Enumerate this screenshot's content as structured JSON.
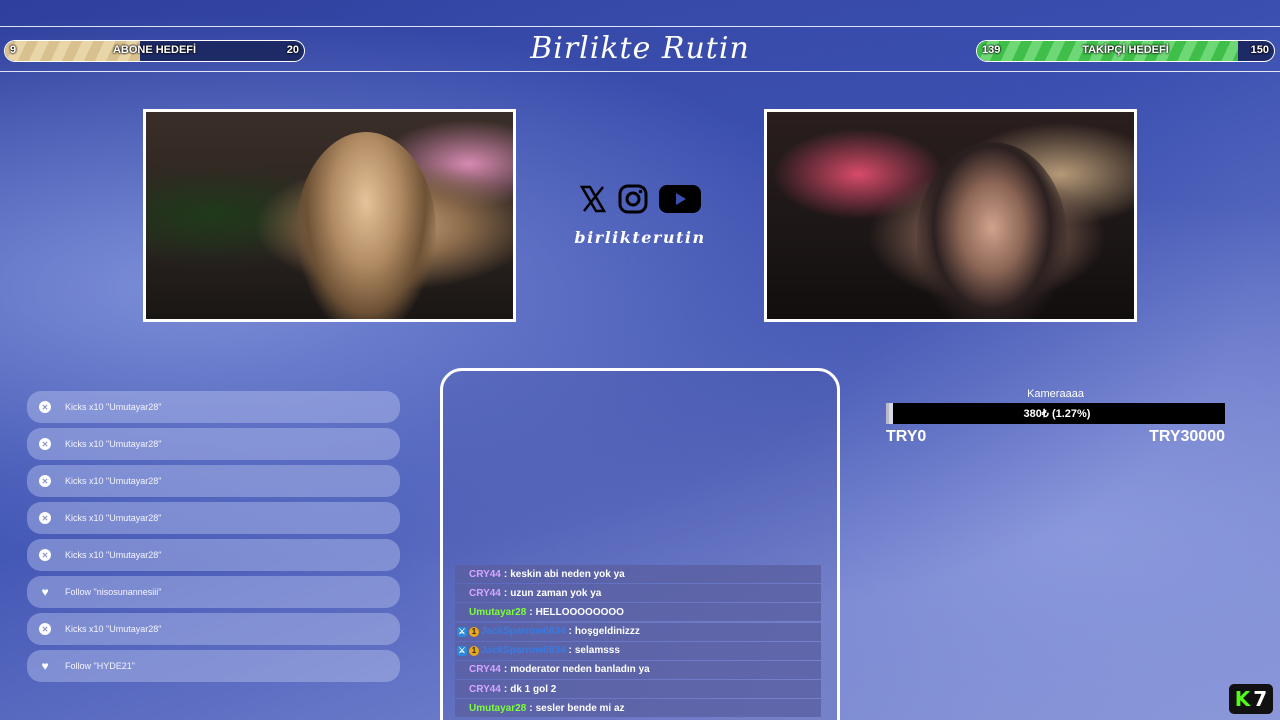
{
  "top_bar": {
    "sub_goal": {
      "min": "9",
      "label": "ABONE HEDEFİ",
      "max": "20",
      "progress": 0.45
    },
    "title": "Birlikte Rutin",
    "follow_goal": {
      "min": "139",
      "label": "TAKİPÇİ HEDEFİ",
      "max": "150",
      "progress": 0.88
    }
  },
  "socials": {
    "icons": [
      "x-icon",
      "instagram-icon",
      "youtube-icon"
    ],
    "handle": "birlikterutin"
  },
  "events": [
    {
      "type": "kick",
      "text": "Kicks x10 \"Umutayar28\""
    },
    {
      "type": "kick",
      "text": "Kicks x10 \"Umutayar28\""
    },
    {
      "type": "kick",
      "text": "Kicks x10 \"Umutayar28\""
    },
    {
      "type": "kick",
      "text": "Kicks x10 \"Umutayar28\""
    },
    {
      "type": "kick",
      "text": "Kicks x10 \"Umutayar28\""
    },
    {
      "type": "follow",
      "text": "Follow \"nisosunannesiii\""
    },
    {
      "type": "kick",
      "text": "Kicks x10 \"Umutayar28\""
    },
    {
      "type": "follow",
      "text": "Follow \"HYDE21\""
    }
  ],
  "chat": [
    {
      "user": "CRY44",
      "color": "#d7a6ff",
      "badges": [],
      "message": "keskin abi neden yok ya"
    },
    {
      "user": "CRY44",
      "color": "#d7a6ff",
      "badges": [],
      "message": "uzun zaman yok ya"
    },
    {
      "user": "Umutayar28",
      "color": "#7dff3a",
      "badges": [],
      "message": "HELLOOOOOOOO"
    },
    {
      "user": "JackSparrow0634",
      "color": "#3a7be0",
      "badges": [
        "mod",
        "sub"
      ],
      "message": "hoşgeldinizzz"
    },
    {
      "user": "JackSparrow0634",
      "color": "#3a7be0",
      "badges": [
        "mod",
        "sub"
      ],
      "message": "selamsss"
    },
    {
      "user": "CRY44",
      "color": "#d7a6ff",
      "badges": [],
      "message": "moderator neden banladın ya"
    },
    {
      "user": "CRY44",
      "color": "#d7a6ff",
      "badges": [],
      "message": "dk 1 gol 2"
    },
    {
      "user": "Umutayar28",
      "color": "#7dff3a",
      "badges": [],
      "message": "sesler bende mi az"
    }
  ],
  "donation": {
    "title": "Kameraaaa",
    "amount_text": "380₺ (1.27%)",
    "progress": 0.0127,
    "min": "TRY0",
    "max": "TRY30000"
  },
  "kick_logo": {
    "k": "K",
    "n": "7"
  }
}
